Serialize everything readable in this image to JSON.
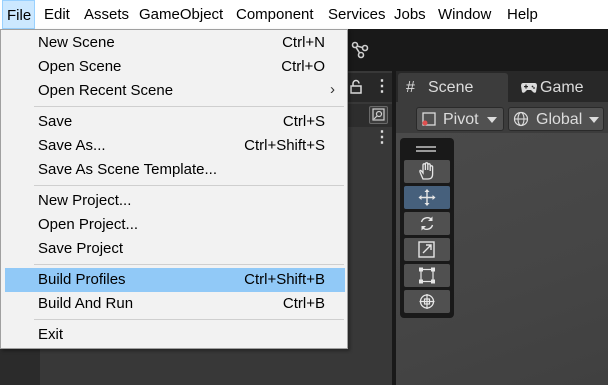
{
  "menubar": {
    "items": [
      "File",
      "Edit",
      "Assets",
      "GameObject",
      "Component",
      "Services",
      "Jobs",
      "Window",
      "Help"
    ]
  },
  "file_menu": {
    "items": [
      {
        "label": "New Scene",
        "shortcut": "Ctrl+N"
      },
      {
        "label": "Open Scene",
        "shortcut": "Ctrl+O"
      },
      {
        "label": "Open Recent Scene",
        "submenu_arrow": "›"
      },
      {
        "label": "Save",
        "shortcut": "Ctrl+S"
      },
      {
        "label": "Save As...",
        "shortcut": "Ctrl+Shift+S"
      },
      {
        "label": "Save As Scene Template..."
      },
      {
        "label": "New Project..."
      },
      {
        "label": "Open Project..."
      },
      {
        "label": "Save Project"
      },
      {
        "label": "Build Profiles",
        "shortcut": "Ctrl+Shift+B",
        "highlighted": true
      },
      {
        "label": "Build And Run",
        "shortcut": "Ctrl+B"
      },
      {
        "label": "Exit"
      }
    ]
  },
  "scene_view": {
    "tabs": [
      {
        "label": "Scene",
        "icon": "grid-icon",
        "active": true
      },
      {
        "label": "Game",
        "icon": "gamepad-icon",
        "active": false
      }
    ],
    "pivot_dropdown": "Pivot",
    "global_dropdown": "Global",
    "tools": [
      "hand-tool-icon",
      "move-tool-icon",
      "rotate-tool-icon",
      "scale-tool-icon",
      "rect-tool-icon",
      "transform-tool-icon"
    ],
    "selected_tool": "move-tool-icon"
  },
  "hierarchy": {
    "icons": [
      "lock-icon",
      "kebab-menu-icon",
      "search-icon"
    ]
  },
  "colors": {
    "menu_highlight": "#91c9f7",
    "menubar_active": "#cce8ff",
    "editor_dark": "#191919",
    "panel_gray": "#383838",
    "tool_selected": "#46607c"
  }
}
